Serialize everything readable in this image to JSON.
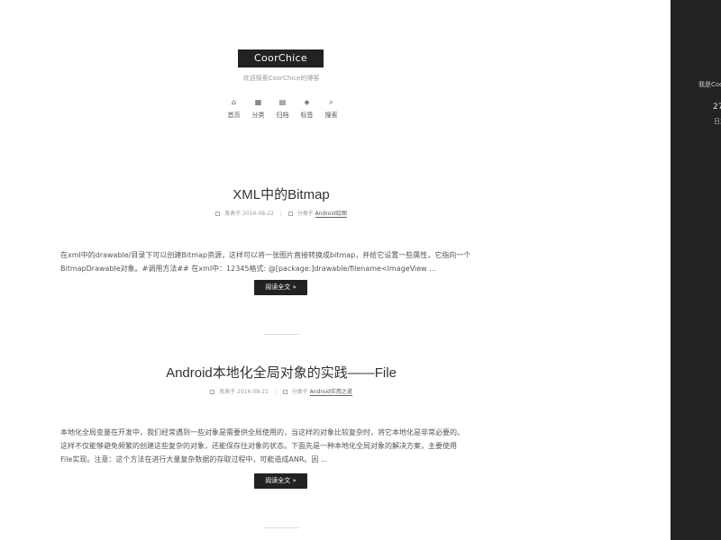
{
  "site": {
    "brand": "CoorChice",
    "subtitle": "欢迎探索CoorChice的博客"
  },
  "menu": [
    {
      "label": "首页",
      "icon": "home-icon",
      "glyph": "⌂"
    },
    {
      "label": "分类",
      "icon": "grid-icon",
      "glyph": "▦"
    },
    {
      "label": "归档",
      "icon": "archive-icon",
      "glyph": "▤"
    },
    {
      "label": "标签",
      "icon": "tags-icon",
      "glyph": "◈"
    },
    {
      "label": "搜索",
      "icon": "search-icon",
      "glyph": "⌕"
    }
  ],
  "posts": [
    {
      "title": "XML中的Bitmap",
      "published_prefix": "发表于",
      "date": "2016-08-22",
      "category_prefix": "分类于",
      "category": "Android绘图",
      "excerpt_line1": "在xml中的drawable/目录下可以创建Bitmap资源，这样可以将一张图片直接转换成bitmap，并给它设置一些属性，它指向一个",
      "excerpt_line2": "BitmapDrawable对象。#调用方法## 在xml中：12345格式: @[package:]drawable/filename<ImageView ...",
      "read_more": "阅读全文 »"
    },
    {
      "title": "Android本地化全局对象的实践——File",
      "published_prefix": "发表于",
      "date": "2016-08-21",
      "category_prefix": "分类于",
      "category": "Android实用之道",
      "excerpt_line1": "本地化全局变量在开发中，我们经常遇到一些对象是需要供全局使用的，当这样的对象比较复杂时，将它本地化是非常必要的。",
      "excerpt_line2": "这样不仅能够避免频繁的创建这些复杂的对象，还能保存住对象的状态。下面先是一种本地化全局对象的解决方案，主要使用",
      "excerpt_line3": "File实现。注意：这个方法在进行大量复杂数据的存取过程中，可能造成ANR。因 ...",
      "read_more": "阅读全文 »"
    }
  ],
  "sidebar": {
    "intro": "我是CoorChice",
    "count": "27",
    "count_label": "日志"
  },
  "colors": {
    "sidebar_bg": "#222222",
    "brand_bg": "#222222",
    "button_bg": "#222222"
  }
}
